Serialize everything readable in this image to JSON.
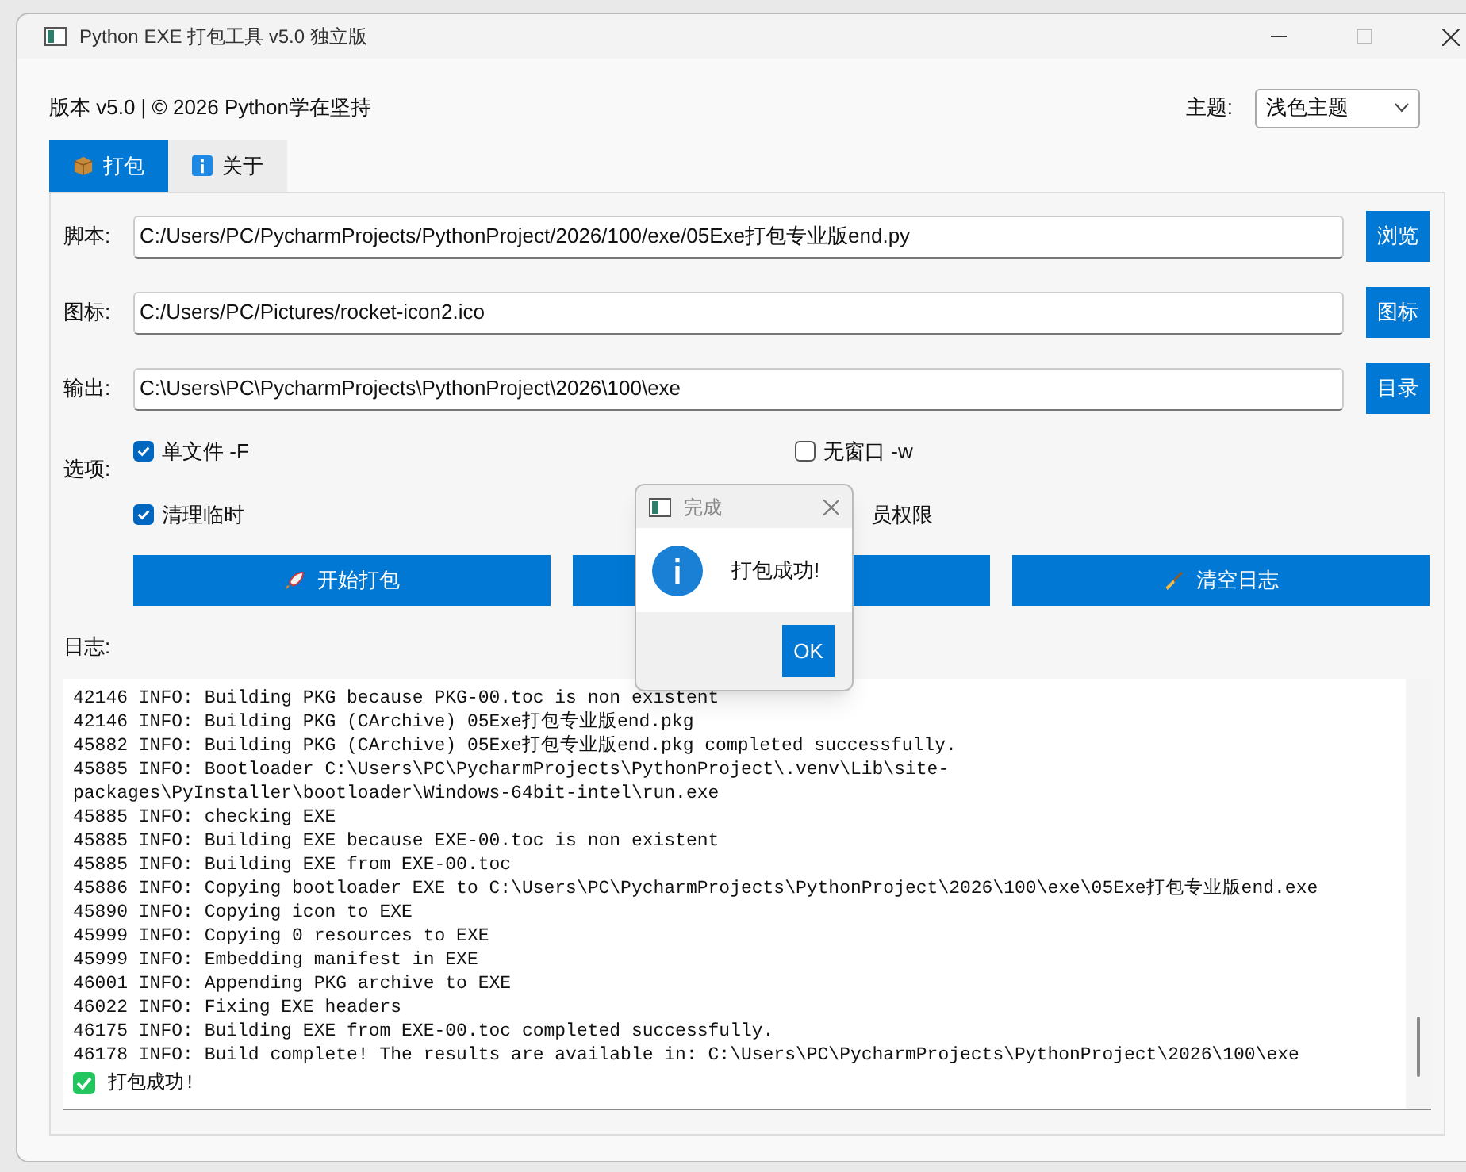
{
  "window": {
    "title": "Python EXE 打包工具 v5.0 独立版"
  },
  "header": {
    "version": "版本 v5.0 | © 2026 Python学在坚持",
    "theme_label": "主题:",
    "theme_value": "浅色主题"
  },
  "tabs": [
    {
      "label": "打包",
      "selected": true,
      "kind": "package"
    },
    {
      "label": "关于",
      "selected": false,
      "kind": "info"
    }
  ],
  "fields": [
    {
      "label": "脚本:",
      "value": "C:/Users/PC/PycharmProjects/PythonProject/2026/100/exe/05Exe打包专业版end.py",
      "button": "浏览"
    },
    {
      "label": "图标:",
      "value": "C:/Users/PC/Pictures/rocket-icon2.ico",
      "button": "图标"
    },
    {
      "label": "输出:",
      "value": "C:\\Users\\PC\\PycharmProjects\\PythonProject\\2026\\100\\exe",
      "button": "目录"
    }
  ],
  "options": {
    "label": "选项:",
    "items": [
      {
        "label": "单文件 -F",
        "checked": true
      },
      {
        "label": "无窗口 -w",
        "checked": false
      },
      {
        "label": "清理临时",
        "checked": true
      },
      {
        "label": "员权限"
      }
    ]
  },
  "actions": [
    {
      "label": "开始打包",
      "kind": "rocket"
    },
    {
      "kind": "hidden"
    },
    {
      "label": "清空日志",
      "kind": "broom"
    }
  ],
  "log": {
    "label": "日志:",
    "lines": [
      "42146 INFO: Building PKG because PKG-00.toc is non existent",
      "42146 INFO: Building PKG (CArchive) 05Exe打包专业版end.pkg",
      "45882 INFO: Building PKG (CArchive) 05Exe打包专业版end.pkg completed successfully.",
      "45885 INFO: Bootloader C:\\Users\\PC\\PycharmProjects\\PythonProject\\.venv\\Lib\\site-",
      "packages\\PyInstaller\\bootloader\\Windows-64bit-intel\\run.exe",
      "45885 INFO: checking EXE",
      "45885 INFO: Building EXE because EXE-00.toc is non existent",
      "45885 INFO: Building EXE from EXE-00.toc",
      "45886 INFO: Copying bootloader EXE to C:\\Users\\PC\\PycharmProjects\\PythonProject\\2026\\100\\exe\\05Exe打包专业版end.exe",
      "45890 INFO: Copying icon to EXE",
      "45999 INFO: Copying 0 resources to EXE",
      "45999 INFO: Embedding manifest in EXE",
      "46001 INFO: Appending PKG archive to EXE",
      "46022 INFO: Fixing EXE headers",
      "46175 INFO: Building EXE from EXE-00.toc completed successfully.",
      "46178 INFO: Build complete! The results are available in: C:\\Users\\PC\\PycharmProjects\\PythonProject\\2026\\100\\exe"
    ],
    "success": "打包成功!"
  },
  "dialog": {
    "title": "完成",
    "message": "打包成功!",
    "button": "OK"
  }
}
